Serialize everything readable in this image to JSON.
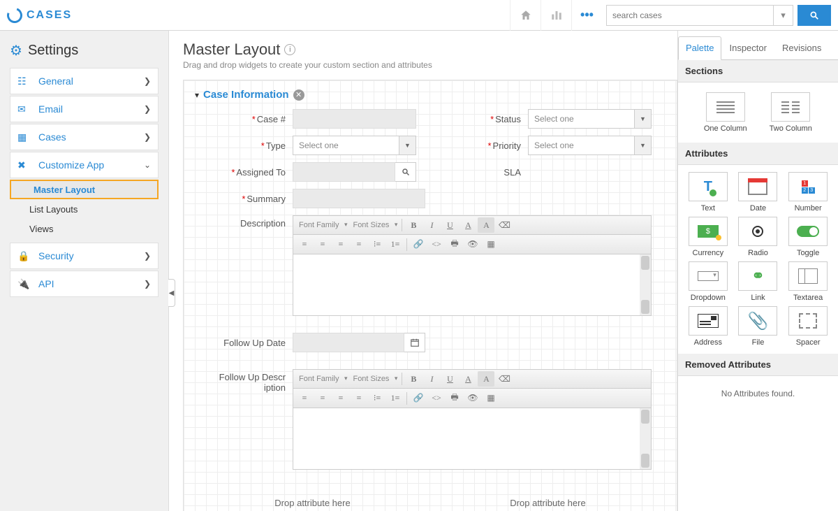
{
  "app": {
    "name": "CASES"
  },
  "topbar": {
    "search_placeholder": "search cases"
  },
  "sidebar": {
    "heading": "Settings",
    "items": [
      {
        "label": "General",
        "expandable": true
      },
      {
        "label": "Email",
        "expandable": true
      },
      {
        "label": "Cases",
        "expandable": true
      },
      {
        "label": "Customize App",
        "expanded": true
      },
      {
        "label": "Security",
        "expandable": true
      },
      {
        "label": "API",
        "expandable": true
      }
    ],
    "sub": {
      "master_layout": "Master Layout",
      "list_layouts": "List Layouts",
      "views": "Views"
    }
  },
  "page": {
    "title": "Master Layout",
    "subtitle": "Drag and drop widgets to create your custom section and attributes"
  },
  "section": {
    "title": "Case Information",
    "fields": {
      "case_no": "Case #",
      "status": "Status",
      "type": "Type",
      "priority": "Priority",
      "assigned_to": "Assigned To",
      "sla": "SLA",
      "summary": "Summary",
      "description": "Description",
      "follow_up_date": "Follow Up Date",
      "follow_up_descr": "Follow Up Descr iption"
    },
    "select_placeholder": "Select one",
    "drop_hint": "Drop attribute here"
  },
  "rte": {
    "font_family": "Font Family",
    "font_sizes": "Font Sizes"
  },
  "panel": {
    "tabs": {
      "palette": "Palette",
      "inspector": "Inspector",
      "revisions": "Revisions"
    },
    "sections_hdr": "Sections",
    "attributes_hdr": "Attributes",
    "removed_hdr": "Removed Attributes",
    "no_attrs": "No Attributes found.",
    "sections": {
      "one_col": "One Column",
      "two_col": "Two Column"
    },
    "attrs": {
      "text": "Text",
      "date": "Date",
      "number": "Number",
      "currency": "Currency",
      "radio": "Radio",
      "toggle": "Toggle",
      "dropdown": "Dropdown",
      "link": "Link",
      "textarea": "Textarea",
      "address": "Address",
      "file": "File",
      "spacer": "Spacer"
    }
  }
}
